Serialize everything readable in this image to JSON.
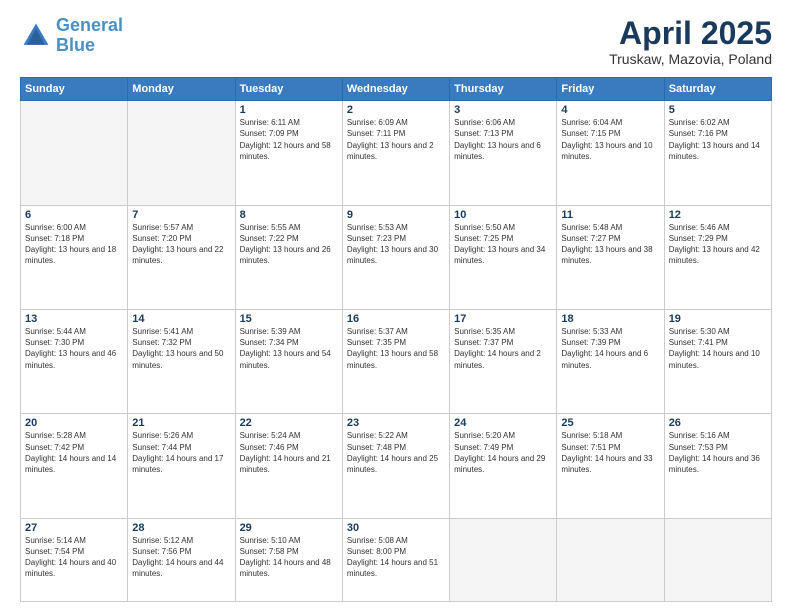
{
  "header": {
    "logo_line1": "General",
    "logo_line2": "Blue",
    "month": "April 2025",
    "location": "Truskaw, Mazovia, Poland"
  },
  "weekdays": [
    "Sunday",
    "Monday",
    "Tuesday",
    "Wednesday",
    "Thursday",
    "Friday",
    "Saturday"
  ],
  "weeks": [
    [
      {
        "day": "",
        "empty": true
      },
      {
        "day": "",
        "empty": true
      },
      {
        "day": "1",
        "sunrise": "Sunrise: 6:11 AM",
        "sunset": "Sunset: 7:09 PM",
        "daylight": "Daylight: 12 hours and 58 minutes."
      },
      {
        "day": "2",
        "sunrise": "Sunrise: 6:09 AM",
        "sunset": "Sunset: 7:11 PM",
        "daylight": "Daylight: 13 hours and 2 minutes."
      },
      {
        "day": "3",
        "sunrise": "Sunrise: 6:06 AM",
        "sunset": "Sunset: 7:13 PM",
        "daylight": "Daylight: 13 hours and 6 minutes."
      },
      {
        "day": "4",
        "sunrise": "Sunrise: 6:04 AM",
        "sunset": "Sunset: 7:15 PM",
        "daylight": "Daylight: 13 hours and 10 minutes."
      },
      {
        "day": "5",
        "sunrise": "Sunrise: 6:02 AM",
        "sunset": "Sunset: 7:16 PM",
        "daylight": "Daylight: 13 hours and 14 minutes."
      }
    ],
    [
      {
        "day": "6",
        "sunrise": "Sunrise: 6:00 AM",
        "sunset": "Sunset: 7:18 PM",
        "daylight": "Daylight: 13 hours and 18 minutes."
      },
      {
        "day": "7",
        "sunrise": "Sunrise: 5:57 AM",
        "sunset": "Sunset: 7:20 PM",
        "daylight": "Daylight: 13 hours and 22 minutes."
      },
      {
        "day": "8",
        "sunrise": "Sunrise: 5:55 AM",
        "sunset": "Sunset: 7:22 PM",
        "daylight": "Daylight: 13 hours and 26 minutes."
      },
      {
        "day": "9",
        "sunrise": "Sunrise: 5:53 AM",
        "sunset": "Sunset: 7:23 PM",
        "daylight": "Daylight: 13 hours and 30 minutes."
      },
      {
        "day": "10",
        "sunrise": "Sunrise: 5:50 AM",
        "sunset": "Sunset: 7:25 PM",
        "daylight": "Daylight: 13 hours and 34 minutes."
      },
      {
        "day": "11",
        "sunrise": "Sunrise: 5:48 AM",
        "sunset": "Sunset: 7:27 PM",
        "daylight": "Daylight: 13 hours and 38 minutes."
      },
      {
        "day": "12",
        "sunrise": "Sunrise: 5:46 AM",
        "sunset": "Sunset: 7:29 PM",
        "daylight": "Daylight: 13 hours and 42 minutes."
      }
    ],
    [
      {
        "day": "13",
        "sunrise": "Sunrise: 5:44 AM",
        "sunset": "Sunset: 7:30 PM",
        "daylight": "Daylight: 13 hours and 46 minutes."
      },
      {
        "day": "14",
        "sunrise": "Sunrise: 5:41 AM",
        "sunset": "Sunset: 7:32 PM",
        "daylight": "Daylight: 13 hours and 50 minutes."
      },
      {
        "day": "15",
        "sunrise": "Sunrise: 5:39 AM",
        "sunset": "Sunset: 7:34 PM",
        "daylight": "Daylight: 13 hours and 54 minutes."
      },
      {
        "day": "16",
        "sunrise": "Sunrise: 5:37 AM",
        "sunset": "Sunset: 7:35 PM",
        "daylight": "Daylight: 13 hours and 58 minutes."
      },
      {
        "day": "17",
        "sunrise": "Sunrise: 5:35 AM",
        "sunset": "Sunset: 7:37 PM",
        "daylight": "Daylight: 14 hours and 2 minutes."
      },
      {
        "day": "18",
        "sunrise": "Sunrise: 5:33 AM",
        "sunset": "Sunset: 7:39 PM",
        "daylight": "Daylight: 14 hours and 6 minutes."
      },
      {
        "day": "19",
        "sunrise": "Sunrise: 5:30 AM",
        "sunset": "Sunset: 7:41 PM",
        "daylight": "Daylight: 14 hours and 10 minutes."
      }
    ],
    [
      {
        "day": "20",
        "sunrise": "Sunrise: 5:28 AM",
        "sunset": "Sunset: 7:42 PM",
        "daylight": "Daylight: 14 hours and 14 minutes."
      },
      {
        "day": "21",
        "sunrise": "Sunrise: 5:26 AM",
        "sunset": "Sunset: 7:44 PM",
        "daylight": "Daylight: 14 hours and 17 minutes."
      },
      {
        "day": "22",
        "sunrise": "Sunrise: 5:24 AM",
        "sunset": "Sunset: 7:46 PM",
        "daylight": "Daylight: 14 hours and 21 minutes."
      },
      {
        "day": "23",
        "sunrise": "Sunrise: 5:22 AM",
        "sunset": "Sunset: 7:48 PM",
        "daylight": "Daylight: 14 hours and 25 minutes."
      },
      {
        "day": "24",
        "sunrise": "Sunrise: 5:20 AM",
        "sunset": "Sunset: 7:49 PM",
        "daylight": "Daylight: 14 hours and 29 minutes."
      },
      {
        "day": "25",
        "sunrise": "Sunrise: 5:18 AM",
        "sunset": "Sunset: 7:51 PM",
        "daylight": "Daylight: 14 hours and 33 minutes."
      },
      {
        "day": "26",
        "sunrise": "Sunrise: 5:16 AM",
        "sunset": "Sunset: 7:53 PM",
        "daylight": "Daylight: 14 hours and 36 minutes."
      }
    ],
    [
      {
        "day": "27",
        "sunrise": "Sunrise: 5:14 AM",
        "sunset": "Sunset: 7:54 PM",
        "daylight": "Daylight: 14 hours and 40 minutes."
      },
      {
        "day": "28",
        "sunrise": "Sunrise: 5:12 AM",
        "sunset": "Sunset: 7:56 PM",
        "daylight": "Daylight: 14 hours and 44 minutes."
      },
      {
        "day": "29",
        "sunrise": "Sunrise: 5:10 AM",
        "sunset": "Sunset: 7:58 PM",
        "daylight": "Daylight: 14 hours and 48 minutes."
      },
      {
        "day": "30",
        "sunrise": "Sunrise: 5:08 AM",
        "sunset": "Sunset: 8:00 PM",
        "daylight": "Daylight: 14 hours and 51 minutes."
      },
      {
        "day": "",
        "empty": true
      },
      {
        "day": "",
        "empty": true
      },
      {
        "day": "",
        "empty": true
      }
    ]
  ]
}
